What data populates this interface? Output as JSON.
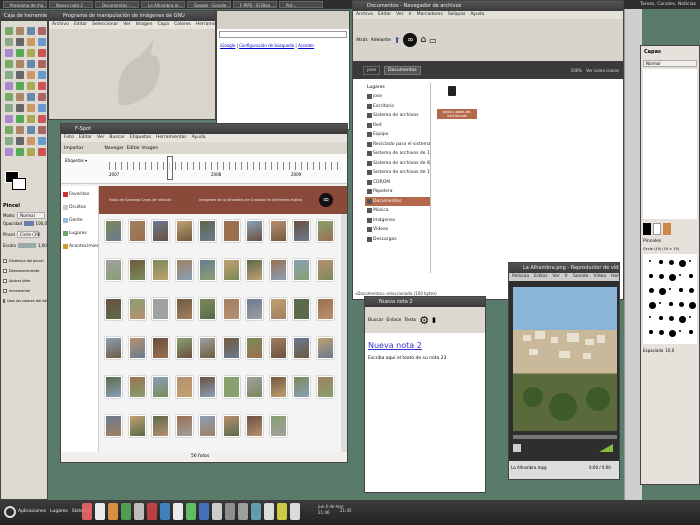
{
  "top_panel": {
    "tasks": [
      "Programa de ma...",
      "Nueva nota 2",
      "Documentos - ...",
      "La Alhambra.m...",
      "Google - Google ...",
      "F-PIPS - El Blog ...",
      "Pot..."
    ],
    "right_app": "Tareas, Canales, Noticias"
  },
  "bottom_panel": {
    "menus": [
      "Aplicaciones",
      "Lugares",
      "Sistema"
    ],
    "clock_line1": "jue 4 de mar",
    "clock_line2": "21:46",
    "clock_right": "21:45"
  },
  "gimp_toolbox": {
    "title": "Caja de herramientas",
    "tool_name": "Pincel",
    "mode_label": "Modo:",
    "mode_value": "Normal",
    "opacity_label": "Opacidad",
    "opacity_value": "100,0",
    "brush_label": "Pincel",
    "brush_value": "Circle (19)",
    "scale_label": "Escala",
    "scale_value": "1,00",
    "options": [
      "Dinámica del pincel",
      "Desvanecimiento",
      "Aplicar jitter",
      "Incremental",
      "Usar los colores del degradado"
    ]
  },
  "gimp_main": {
    "title": "Programa de manipulación de imágenes de GNU",
    "menu": [
      "Archivo",
      "Editar",
      "Seleccionar",
      "Ver",
      "Imagen",
      "Capa",
      "Colores",
      "Herramientas",
      "Filtros",
      "Ventanas",
      "Ayuda"
    ]
  },
  "browser": {
    "link1": "iGoogle",
    "link2": "Configuración de búsqueda",
    "link3": "Acceder"
  },
  "fspot": {
    "title": "F-Spot",
    "menu": [
      "Foto",
      "Editar",
      "Ver",
      "Buscar",
      "Etiquetas",
      "Herramientas",
      "Ayuda"
    ],
    "toolbar": [
      "Importar",
      "Navegar",
      "Editar imagen"
    ],
    "timeline": [
      "2007",
      "2008",
      "2009"
    ],
    "tags": [
      "Favoritos",
      "Ocultos",
      "Gente",
      "Lugares",
      "Acontecimientos"
    ],
    "banner_left": "Fotos de Granada    Caras de relación",
    "banner_right": "Imágenes de la Alhambra de Granada en diferentes estilos",
    "status": "56 fotos"
  },
  "nautilus": {
    "title": "Documentos - Navegador de archivos",
    "menu": [
      "Archivo",
      "Editar",
      "Ver",
      "Ir",
      "Marcadores",
      "Solapas",
      "Ayuda"
    ],
    "path": [
      "Atrás",
      "Adelante"
    ],
    "crumbs": [
      "jose",
      "Documentos"
    ],
    "zoom": "100%",
    "view": "Ver como iconos",
    "places_title": "Lugares",
    "places": [
      "jose",
      "Escritorio",
      "Sistema de archivos",
      "Red",
      "Equipo",
      "Reciclado para el sistema",
      "Sistema de archivos de 100 GB",
      "Sistema de archivos de 80 GB",
      "Sistema de archivos de 160 GB",
      "CDROM",
      "Papelera",
      "Documentos",
      "Música",
      "Imágenes",
      "Vídeos",
      "Descargas"
    ],
    "file_label": "polla-y-tabla-de-escribir.odt",
    "status": "«Documentos» seleccionado (100 bytes)"
  },
  "tomboy": {
    "title": "Nueva nota 2",
    "toolbar": [
      "Buscar",
      "Enlace",
      "Texto"
    ],
    "heading": "Nueva nota 2",
    "body": "Escriba aquí el texto de su nota 23"
  },
  "totem": {
    "title": "La Alhambra.png - Reproductor de vídeo",
    "menu": [
      "Película",
      "Editar",
      "Ver",
      "Ir",
      "Sonido",
      "Vídeo",
      "Herramientas",
      "Ayuda"
    ],
    "status": "La Alhambra.mpg",
    "time": "0:00 / 0:00"
  },
  "gimp_layers": {
    "title": "Capas",
    "mode": "Normal",
    "brushes_title": "Pinceles",
    "brush_name": "Circle (19) (19 × 19)",
    "spacing_label": "Espaciado",
    "spacing_value": "10,0"
  },
  "colors": {
    "desktop": "#5a7a6a",
    "fspot_banner": "#8a4a3a",
    "nautilus_selected": "#b46a4a"
  }
}
